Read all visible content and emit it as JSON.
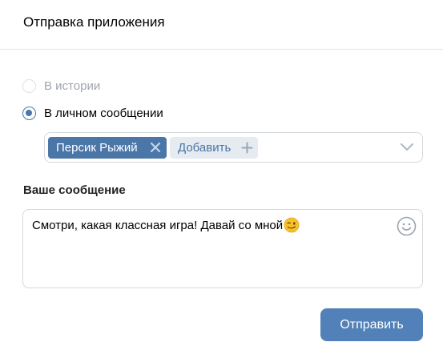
{
  "dialog": {
    "title": "Отправка приложения"
  },
  "share_options": [
    {
      "label": "В истории",
      "state": "disabled"
    },
    {
      "label": "В личном сообщении",
      "state": "selected"
    }
  ],
  "recipients": {
    "selected": [
      "Персик Рыжий"
    ],
    "add_label": "Добавить",
    "icons": {
      "remove": "close-icon",
      "add": "plus-icon",
      "dropdown": "chevron-down-icon"
    }
  },
  "message": {
    "label": "Ваше сообщение",
    "text": "Смотри, какая классная игра! Давай со мной",
    "emoji": "winking-face-emoji",
    "smiley_icon": "smiley-icon"
  },
  "actions": {
    "send_label": "Отправить"
  },
  "colors": {
    "accent": "#4a76a8",
    "button": "#5181b8",
    "chip_add_bg": "#e5ebf1",
    "border": "#d3d9de",
    "disabled_text": "#a0a5ad"
  }
}
